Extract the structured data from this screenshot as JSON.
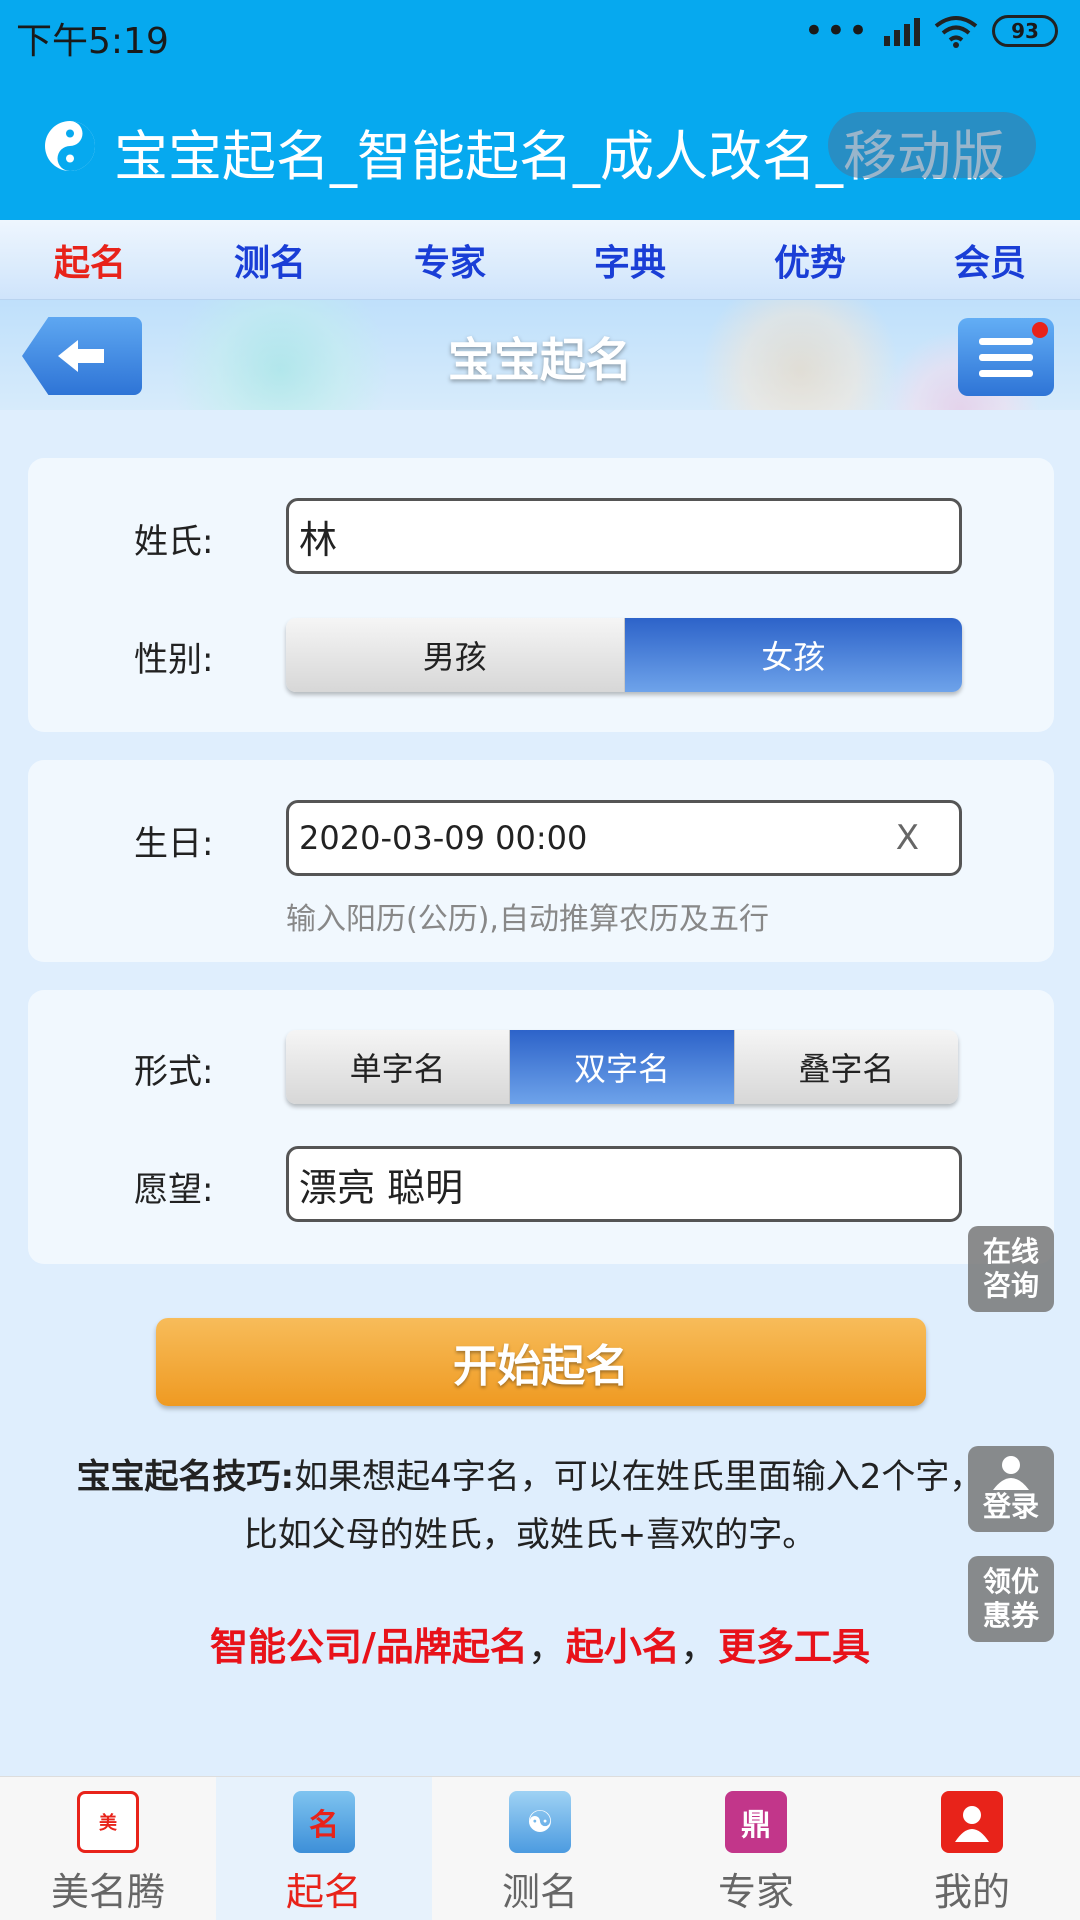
{
  "status_bar": {
    "time": "下午5:19",
    "battery": "93"
  },
  "title_bar": {
    "title": "宝宝起名_智能起名_成人改名_移动版"
  },
  "nav": {
    "items": [
      "起名",
      "测名",
      "专家",
      "字典",
      "优势",
      "会员"
    ],
    "active": "起名"
  },
  "page": {
    "title": "宝宝起名"
  },
  "form": {
    "surname_label": "姓氏:",
    "surname_value": "林",
    "gender_label": "性别:",
    "gender_options": [
      "男孩",
      "女孩"
    ],
    "gender_selected": "女孩",
    "birthday_label": "生日:",
    "birthday_value": "2020-03-09 00:00",
    "birthday_clear": "X",
    "birthday_hint": "输入阳历(公历),自动推算农历及五行",
    "style_label": "形式:",
    "style_options": [
      "单字名",
      "双字名",
      "叠字名"
    ],
    "style_selected": "双字名",
    "wish_label": "愿望:",
    "wish_value": "漂亮 聪明",
    "start_button": "开始起名"
  },
  "tips": {
    "heading": "宝宝起名技巧:",
    "text": "如果想起4字名，可以在姓氏里面输入2个字，比如父母的姓氏，或姓氏+喜欢的字。"
  },
  "links": {
    "items": [
      "智能公司/品牌起名",
      "起小名",
      "更多工具"
    ],
    "separator": "，"
  },
  "floating": {
    "consult": "在线咨询",
    "login": "登录",
    "coupon": "领优惠券"
  },
  "tabbar": {
    "items": [
      {
        "label": "美名腾",
        "icon": "brand-logo-icon"
      },
      {
        "label": "起名",
        "icon": "naming-icon"
      },
      {
        "label": "测名",
        "icon": "name-test-icon"
      },
      {
        "label": "专家",
        "icon": "expert-icon"
      },
      {
        "label": "我的",
        "icon": "profile-icon"
      }
    ],
    "active": "起名"
  }
}
